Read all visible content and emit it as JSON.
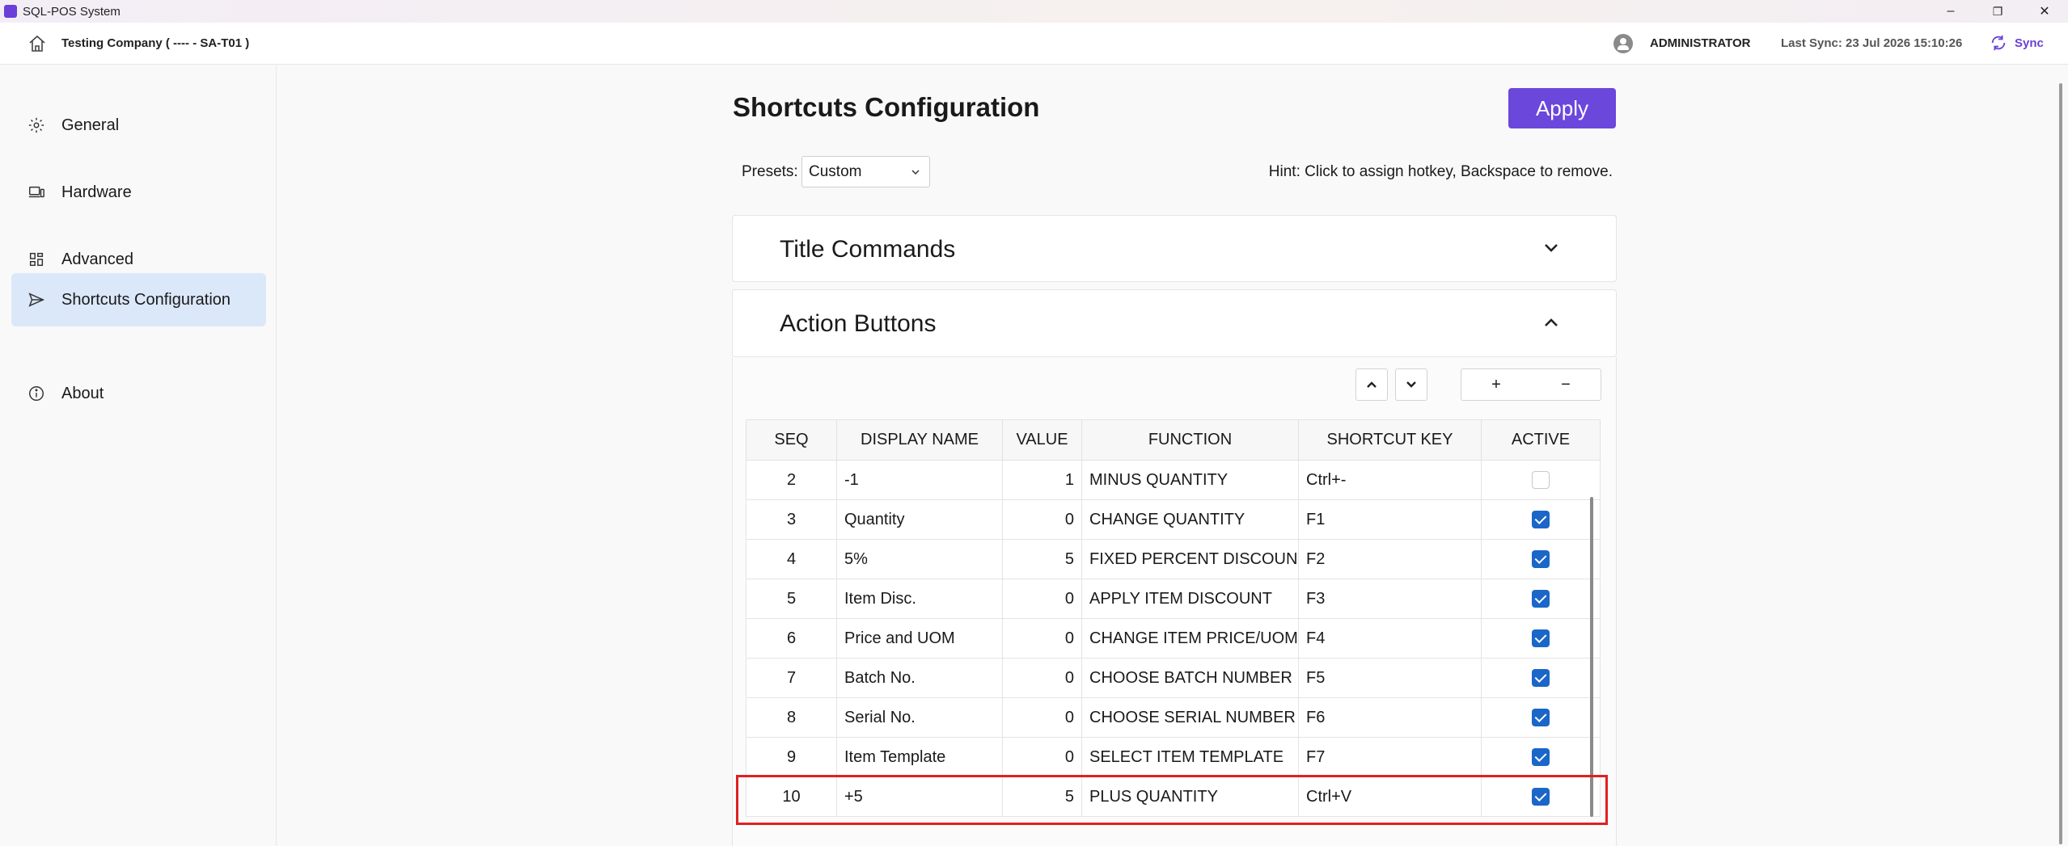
{
  "window": {
    "title": "SQL-POS System",
    "minimize": "–",
    "restore": "❐",
    "close": "✕"
  },
  "header": {
    "company": "Testing Company ( ---- - SA-T01 )",
    "user": "ADMINISTRATOR",
    "last_sync": "Last Sync: 23 Jul 2026 15:10:26",
    "sync_label": "Sync"
  },
  "sidebar": {
    "items": [
      {
        "label": "General",
        "icon": "gear-icon"
      },
      {
        "label": "Hardware",
        "icon": "devices-icon"
      },
      {
        "label": "Advanced",
        "icon": "grid-icon"
      },
      {
        "label": "Shortcuts Configuration",
        "icon": "send-icon"
      },
      {
        "label": "About",
        "icon": "info-icon"
      }
    ]
  },
  "main": {
    "title": "Shortcuts Configuration",
    "apply_label": "Apply",
    "presets_label": "Presets:",
    "presets_value": "Custom",
    "hint": "Hint: Click to assign hotkey, Backspace to remove.",
    "panels": [
      {
        "title": "Title Commands",
        "expanded": false
      },
      {
        "title": "Action Buttons",
        "expanded": true
      }
    ],
    "add_label": "+",
    "remove_label": "−"
  },
  "table": {
    "columns": [
      "SEQ",
      "DISPLAY NAME",
      "VALUE",
      "FUNCTION",
      "SHORTCUT KEY",
      "ACTIVE"
    ],
    "rows": [
      {
        "seq": "2",
        "name": "-1",
        "value": "1",
        "function": "MINUS QUANTITY",
        "key": "Ctrl+-",
        "active": false
      },
      {
        "seq": "3",
        "name": "Quantity",
        "value": "0",
        "function": "CHANGE QUANTITY",
        "key": "F1",
        "active": true
      },
      {
        "seq": "4",
        "name": "5%",
        "value": "5",
        "function": "FIXED PERCENT DISCOUNT",
        "key": "F2",
        "active": true
      },
      {
        "seq": "5",
        "name": "Item Disc.",
        "value": "0",
        "function": "APPLY ITEM DISCOUNT",
        "key": "F3",
        "active": true
      },
      {
        "seq": "6",
        "name": "Price and UOM",
        "value": "0",
        "function": "CHANGE ITEM PRICE/UOM",
        "key": "F4",
        "active": true
      },
      {
        "seq": "7",
        "name": "Batch No.",
        "value": "0",
        "function": "CHOOSE BATCH NUMBER",
        "key": "F5",
        "active": true
      },
      {
        "seq": "8",
        "name": "Serial No.",
        "value": "0",
        "function": "CHOOSE SERIAL NUMBER",
        "key": "F6",
        "active": true
      },
      {
        "seq": "9",
        "name": "Item Template",
        "value": "0",
        "function": "SELECT ITEM TEMPLATE",
        "key": "F7",
        "active": true
      },
      {
        "seq": "10",
        "name": "+5",
        "value": "5",
        "function": "PLUS QUANTITY",
        "key": "Ctrl+V",
        "active": true
      }
    ]
  },
  "colors": {
    "accent": "#6b47dc",
    "checkbox": "#1b66c9",
    "highlight": "#e02020",
    "active_nav": "#dbe8f9"
  }
}
